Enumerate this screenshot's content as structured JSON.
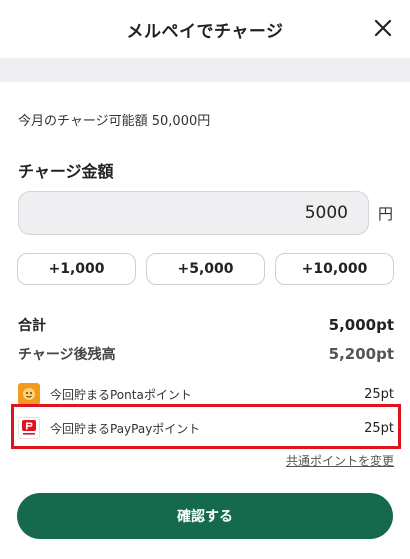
{
  "header": {
    "title": "メルペイでチャージ",
    "close_icon": "close-icon"
  },
  "charge": {
    "limit_text": "今月のチャージ可能額 50,000円",
    "section_title": "チャージ金額",
    "amount_value": "5000",
    "amount_unit": "円",
    "quick_amounts": [
      "+1,000",
      "+5,000",
      "+10,000"
    ]
  },
  "summary": {
    "total_label": "合計",
    "total_value": "5,000pt",
    "balance_label": "チャージ後残高",
    "balance_value": "5,200pt"
  },
  "points": {
    "ponta": {
      "icon": "ponta-icon",
      "name": "今回貯まるPontaポイント",
      "value": "25pt",
      "icon_color": "#f39a1e"
    },
    "paypay": {
      "icon": "paypay-icon",
      "name": "今回貯まるPayPayポイント",
      "value": "25pt",
      "icon_color": "#e0141f"
    },
    "change_link": "共通ポイントを変更"
  },
  "footer": {
    "confirm_label": "確認する",
    "confirm_color": "#156a4e"
  },
  "highlight_color": "#e0141f"
}
